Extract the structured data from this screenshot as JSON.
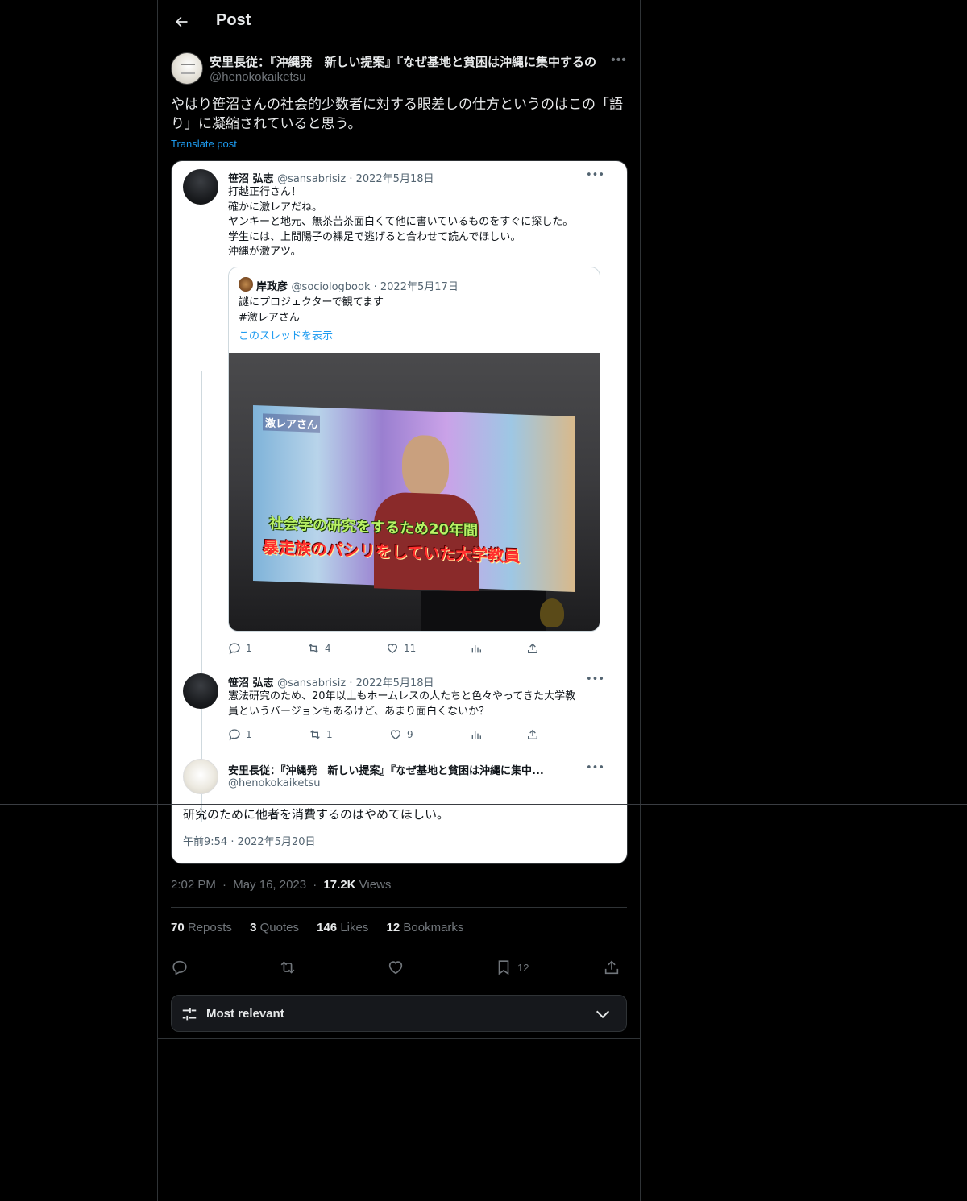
{
  "topbar": {
    "title": "Post"
  },
  "author": {
    "name": "安里長従：『沖縄発　新しい提案』『なぜ基地と貧困は沖縄に集中するの",
    "handle": "@henokokaiketsu"
  },
  "post": {
    "text": "やはり笹沼さんの社会的少数者に対する眼差しの仕方というのはこの「語り」に凝縮されていると思う。",
    "translate_label": "Translate post"
  },
  "screenshot": {
    "tweet1": {
      "name": "笹沼 弘志",
      "meta": "@sansabrisiz · 2022年5月18日",
      "lines": [
        "打越正行さん！",
        "確かに激レアだね。",
        "ヤンキーと地元、無茶苦茶面白くて他に書いているものをすぐに探した。",
        "学生には、上間陽子の裸足で逃げると合わせて読んでほしい。",
        "沖縄が激アツ。"
      ],
      "replies": "1",
      "retweets": "4",
      "likes": "11"
    },
    "quote": {
      "name": "岸政彦",
      "meta": "@sociologbook · 2022年5月17日",
      "lines": [
        "謎にプロジェクターで観てます",
        "#激レアさん"
      ],
      "link": "このスレッドを表示",
      "image_tag": "激レアさん",
      "caption1": "社会学の研究をするため20年間",
      "caption2": "暴走族のパシリをしていた大学教員"
    },
    "tweet2": {
      "name": "笹沼 弘志",
      "meta": "@sansabrisiz · 2022年5月18日",
      "lines": [
        "憲法研究のため、20年以上もホームレスの人たちと色々やってきた大学教",
        "員というバージョンもあるけど、あまり面白くないか？"
      ],
      "replies": "1",
      "retweets": "1",
      "likes": "9"
    },
    "tweet3": {
      "name": "安里長従：『沖縄発　新しい提案』『なぜ基地と貧困は沖縄に集中...",
      "handle": "@henokokaiketsu",
      "text": "研究のために他者を消費するのはやめてほしい。",
      "time": "午前9:54 · 2022年5月20日"
    }
  },
  "meta": {
    "time": "2:02 PM",
    "date": "May 16, 2023",
    "views": "17.2K",
    "views_label": "Views",
    "sep": "·"
  },
  "stats": {
    "reposts": "70",
    "reposts_label": "Reposts",
    "quotes": "3",
    "quotes_label": "Quotes",
    "likes": "146",
    "likes_label": "Likes",
    "bookmarks": "12",
    "bookmarks_label": "Bookmarks"
  },
  "actions": {
    "bookmark_count": "12"
  },
  "sort": {
    "label": "Most relevant"
  },
  "colors": {
    "accent": "#1d9bf0",
    "background": "#000000",
    "muted": "#71767b"
  }
}
